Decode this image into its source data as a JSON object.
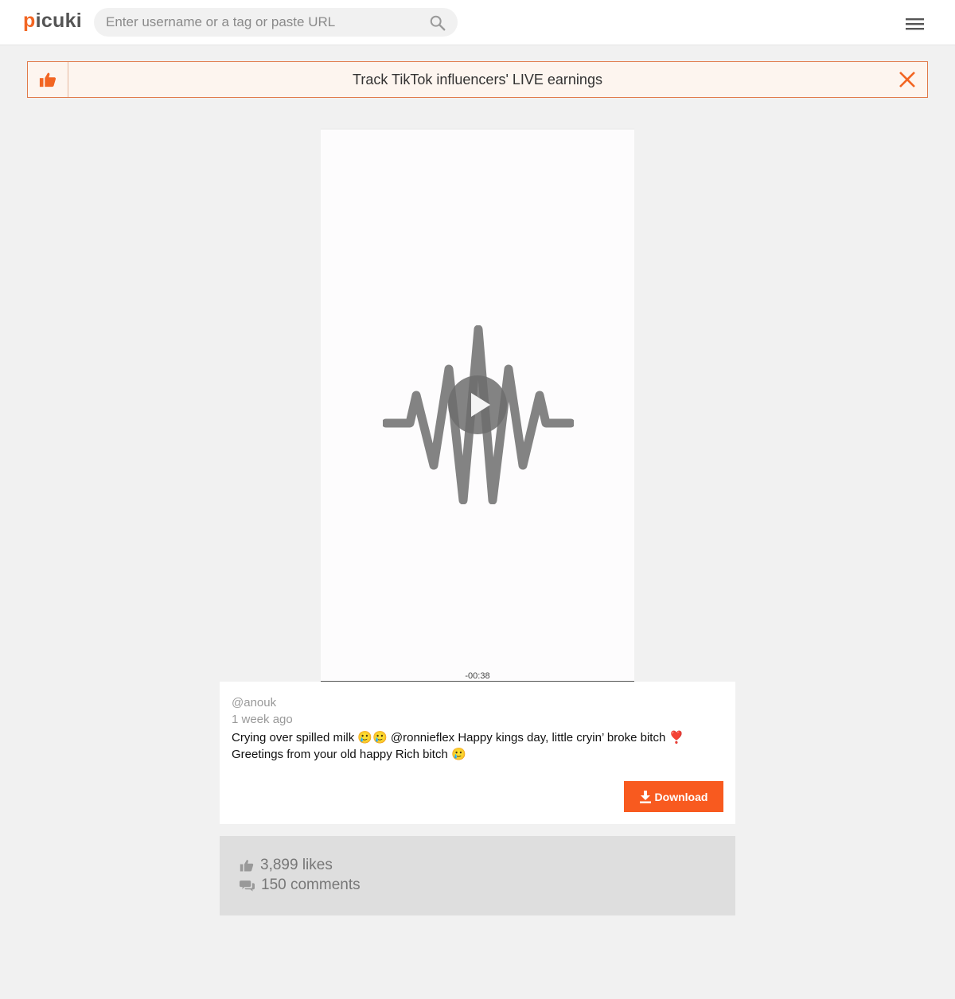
{
  "header": {
    "logo_first": "p",
    "logo_rest": "icuki",
    "search_placeholder": "Enter username or a tag or paste URL",
    "search_icon": "search-icon",
    "menu_icon": "hamburger-menu-icon"
  },
  "banner": {
    "text": "Track TikTok influencers' LIVE earnings",
    "left_icon": "thumbs-up-icon",
    "close_icon": "close-icon"
  },
  "video": {
    "remaining_time": "-00:38",
    "play_icon": "play-icon"
  },
  "post": {
    "username": "@anouk",
    "posted": "1 week ago",
    "caption": "Crying over spilled milk 🥲🥲 @ronnieflex Happy kings day, little cryin’ broke bitch ❣️ Greetings from your old happy Rich bitch 🥲",
    "download_label": "Download"
  },
  "stats": {
    "likes": "3,899 likes",
    "comments": "150 comments"
  },
  "colors": {
    "accent": "#f26522",
    "download_button": "#f85a1f",
    "banner_border": "#e07a4a"
  }
}
